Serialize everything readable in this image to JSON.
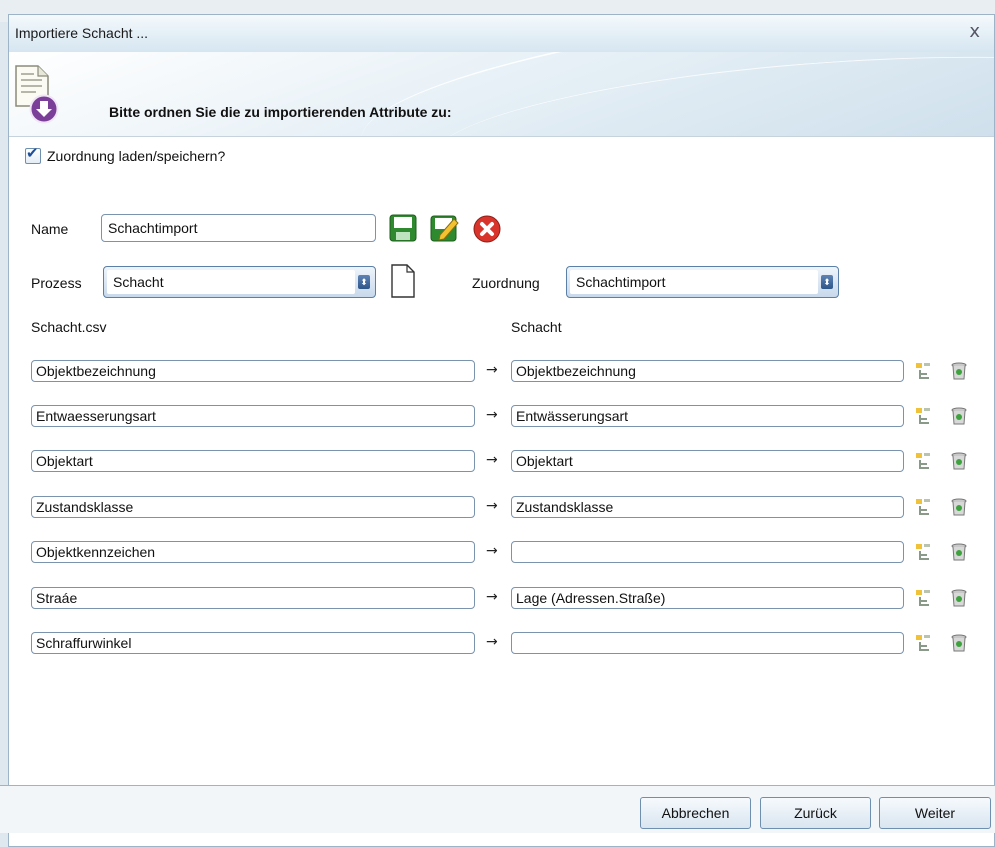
{
  "dialog": {
    "title": "Importiere Schacht ...",
    "close_glyph": "x",
    "heading": "Bitte ordnen Sie die zu importierenden Attribute zu:"
  },
  "form": {
    "checkbox_label": "Zuordnung laden/speichern?",
    "checkbox_checked": true,
    "name_label": "Name",
    "name_value": "Schachtimport",
    "prozess_label": "Prozess",
    "prozess_value": "Schacht",
    "zuordnung_label": "Zuordnung",
    "zuordnung_value": "Schachtimport",
    "source_header": "Schacht.csv",
    "target_header": "Schacht"
  },
  "mappings": [
    {
      "source": "Objektbezeichnung",
      "target": "Objektbezeichnung"
    },
    {
      "source": "Entwaesserungsart",
      "target": "Entwässerungsart"
    },
    {
      "source": "Objektart",
      "target": "Objektart"
    },
    {
      "source": "Zustandsklasse",
      "target": "Zustandsklasse"
    },
    {
      "source": "Objektkennzeichen",
      "target": ""
    },
    {
      "source": "Straáe",
      "target": "Lage (Adressen.Straße)"
    },
    {
      "source": "Schraffurwinkel",
      "target": ""
    }
  ],
  "arrow_glyph": "→",
  "buttons": {
    "cancel": "Abbrechen",
    "back": "Zurück",
    "next": "Weiter"
  },
  "icons": {
    "save": "save-icon",
    "edit": "edit-icon",
    "delete": "delete-icon",
    "new": "new-document-icon",
    "assign": "assign-icon",
    "trash": "trash-icon"
  },
  "colors": {
    "accent": "#2f5688",
    "border": "#7a94ad",
    "delete_red": "#d9342b"
  }
}
